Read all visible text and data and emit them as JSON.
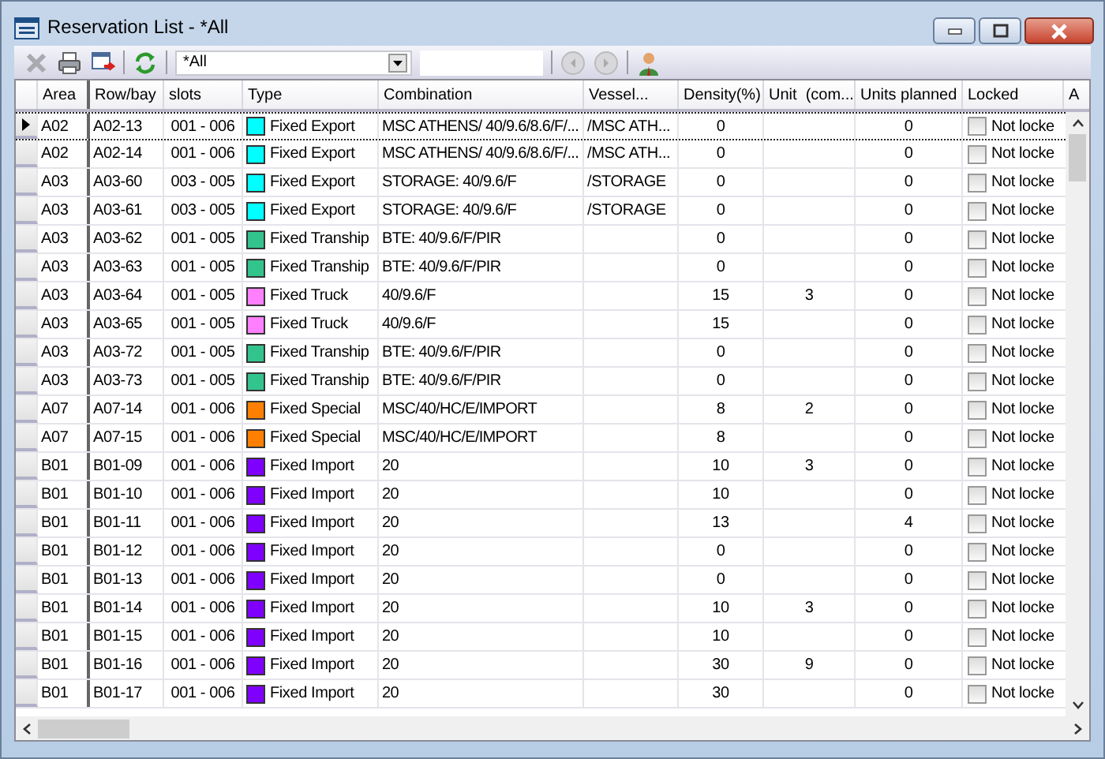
{
  "window": {
    "title": "Reservation List - *All"
  },
  "toolbar": {
    "filter": "*All"
  },
  "columns": [
    "Area",
    "Row/bay",
    "slots",
    "Type",
    "Combination",
    "Vessel...",
    "Density(%)",
    "Unit  (com...",
    "Units planned",
    "Locked",
    "A"
  ],
  "rows": [
    {
      "current": true,
      "area": "A02",
      "row_bay": "A02-13",
      "slots": "001 - 006",
      "type": "Fixed Export",
      "color": "#00ffff",
      "combination": "MSC ATHENS/ 40/9.6/8.6/F/...",
      "vessel": "/MSC ATH...",
      "density": "0",
      "unit": "",
      "planned": "0",
      "locked": false,
      "locked_label": "Not locke"
    },
    {
      "current": false,
      "area": "A02",
      "row_bay": "A02-14",
      "slots": "001 - 006",
      "type": "Fixed Export",
      "color": "#00ffff",
      "combination": "MSC ATHENS/ 40/9.6/8.6/F/...",
      "vessel": "/MSC ATH...",
      "density": "0",
      "unit": "",
      "planned": "0",
      "locked": false,
      "locked_label": "Not locke"
    },
    {
      "current": false,
      "area": "A03",
      "row_bay": "A03-60",
      "slots": "003 - 005",
      "type": "Fixed Export",
      "color": "#00ffff",
      "combination": "STORAGE: 40/9.6/F",
      "vessel": "/STORAGE",
      "density": "0",
      "unit": "",
      "planned": "0",
      "locked": false,
      "locked_label": "Not locke"
    },
    {
      "current": false,
      "area": "A03",
      "row_bay": "A03-61",
      "slots": "003 - 005",
      "type": "Fixed Export",
      "color": "#00ffff",
      "combination": "STORAGE: 40/9.6/F",
      "vessel": "/STORAGE",
      "density": "0",
      "unit": "",
      "planned": "0",
      "locked": false,
      "locked_label": "Not locke"
    },
    {
      "current": false,
      "area": "A03",
      "row_bay": "A03-62",
      "slots": "001 - 005",
      "type": "Fixed Tranship",
      "color": "#33c48e",
      "combination": "BTE: 40/9.6/F/PIR",
      "vessel": "",
      "density": "0",
      "unit": "",
      "planned": "0",
      "locked": false,
      "locked_label": "Not locke"
    },
    {
      "current": false,
      "area": "A03",
      "row_bay": "A03-63",
      "slots": "001 - 005",
      "type": "Fixed Tranship",
      "color": "#33c48e",
      "combination": "BTE: 40/9.6/F/PIR",
      "vessel": "",
      "density": "0",
      "unit": "",
      "planned": "0",
      "locked": false,
      "locked_label": "Not locke"
    },
    {
      "current": false,
      "area": "A03",
      "row_bay": "A03-64",
      "slots": "001 - 005",
      "type": "Fixed Truck",
      "color": "#ff80ff",
      "combination": "40/9.6/F",
      "vessel": "",
      "density": "15",
      "unit": "3",
      "planned": "0",
      "locked": false,
      "locked_label": "Not locke"
    },
    {
      "current": false,
      "area": "A03",
      "row_bay": "A03-65",
      "slots": "001 - 005",
      "type": "Fixed Truck",
      "color": "#ff80ff",
      "combination": "40/9.6/F",
      "vessel": "",
      "density": "15",
      "unit": "",
      "planned": "0",
      "locked": false,
      "locked_label": "Not locke"
    },
    {
      "current": false,
      "area": "A03",
      "row_bay": "A03-72",
      "slots": "001 - 005",
      "type": "Fixed Tranship",
      "color": "#33c48e",
      "combination": "BTE: 40/9.6/F/PIR",
      "vessel": "",
      "density": "0",
      "unit": "",
      "planned": "0",
      "locked": false,
      "locked_label": "Not locke"
    },
    {
      "current": false,
      "area": "A03",
      "row_bay": "A03-73",
      "slots": "001 - 005",
      "type": "Fixed Tranship",
      "color": "#33c48e",
      "combination": "BTE: 40/9.6/F/PIR",
      "vessel": "",
      "density": "0",
      "unit": "",
      "planned": "0",
      "locked": false,
      "locked_label": "Not locke"
    },
    {
      "current": false,
      "area": "A07",
      "row_bay": "A07-14",
      "slots": "001 - 006",
      "type": "Fixed Special",
      "color": "#ff8000",
      "combination": "MSC/40/HC/E/IMPORT",
      "vessel": "",
      "density": "8",
      "unit": "2",
      "planned": "0",
      "locked": false,
      "locked_label": "Not locke"
    },
    {
      "current": false,
      "area": "A07",
      "row_bay": "A07-15",
      "slots": "001 - 006",
      "type": "Fixed Special",
      "color": "#ff8000",
      "combination": "MSC/40/HC/E/IMPORT",
      "vessel": "",
      "density": "8",
      "unit": "",
      "planned": "0",
      "locked": false,
      "locked_label": "Not locke"
    },
    {
      "current": false,
      "area": "B01",
      "row_bay": "B01-09",
      "slots": "001 - 006",
      "type": "Fixed Import",
      "color": "#8000ff",
      "combination": "20",
      "vessel": "",
      "density": "10",
      "unit": "3",
      "planned": "0",
      "locked": false,
      "locked_label": "Not locke"
    },
    {
      "current": false,
      "area": "B01",
      "row_bay": "B01-10",
      "slots": "001 - 006",
      "type": "Fixed Import",
      "color": "#8000ff",
      "combination": "20",
      "vessel": "",
      "density": "10",
      "unit": "",
      "planned": "0",
      "locked": false,
      "locked_label": "Not locke"
    },
    {
      "current": false,
      "area": "B01",
      "row_bay": "B01-11",
      "slots": "001 - 006",
      "type": "Fixed Import",
      "color": "#8000ff",
      "combination": "20",
      "vessel": "",
      "density": "13",
      "unit": "",
      "planned": "4",
      "locked": false,
      "locked_label": "Not locke"
    },
    {
      "current": false,
      "area": "B01",
      "row_bay": "B01-12",
      "slots": "001 - 006",
      "type": "Fixed Import",
      "color": "#8000ff",
      "combination": "20",
      "vessel": "",
      "density": "0",
      "unit": "",
      "planned": "0",
      "locked": false,
      "locked_label": "Not locke"
    },
    {
      "current": false,
      "area": "B01",
      "row_bay": "B01-13",
      "slots": "001 - 006",
      "type": "Fixed Import",
      "color": "#8000ff",
      "combination": "20",
      "vessel": "",
      "density": "0",
      "unit": "",
      "planned": "0",
      "locked": false,
      "locked_label": "Not locke"
    },
    {
      "current": false,
      "area": "B01",
      "row_bay": "B01-14",
      "slots": "001 - 006",
      "type": "Fixed Import",
      "color": "#8000ff",
      "combination": "20",
      "vessel": "",
      "density": "10",
      "unit": "3",
      "planned": "0",
      "locked": false,
      "locked_label": "Not locke"
    },
    {
      "current": false,
      "area": "B01",
      "row_bay": "B01-15",
      "slots": "001 - 006",
      "type": "Fixed Import",
      "color": "#8000ff",
      "combination": "20",
      "vessel": "",
      "density": "10",
      "unit": "",
      "planned": "0",
      "locked": false,
      "locked_label": "Not locke"
    },
    {
      "current": false,
      "area": "B01",
      "row_bay": "B01-16",
      "slots": "001 - 006",
      "type": "Fixed Import",
      "color": "#8000ff",
      "combination": "20",
      "vessel": "",
      "density": "30",
      "unit": "9",
      "planned": "0",
      "locked": false,
      "locked_label": "Not locke"
    },
    {
      "current": false,
      "area": "B01",
      "row_bay": "B01-17",
      "slots": "001 - 006",
      "type": "Fixed Import",
      "color": "#8000ff",
      "combination": "20",
      "vessel": "",
      "density": "30",
      "unit": "",
      "planned": "0",
      "locked": false,
      "locked_label": "Not locke"
    }
  ]
}
